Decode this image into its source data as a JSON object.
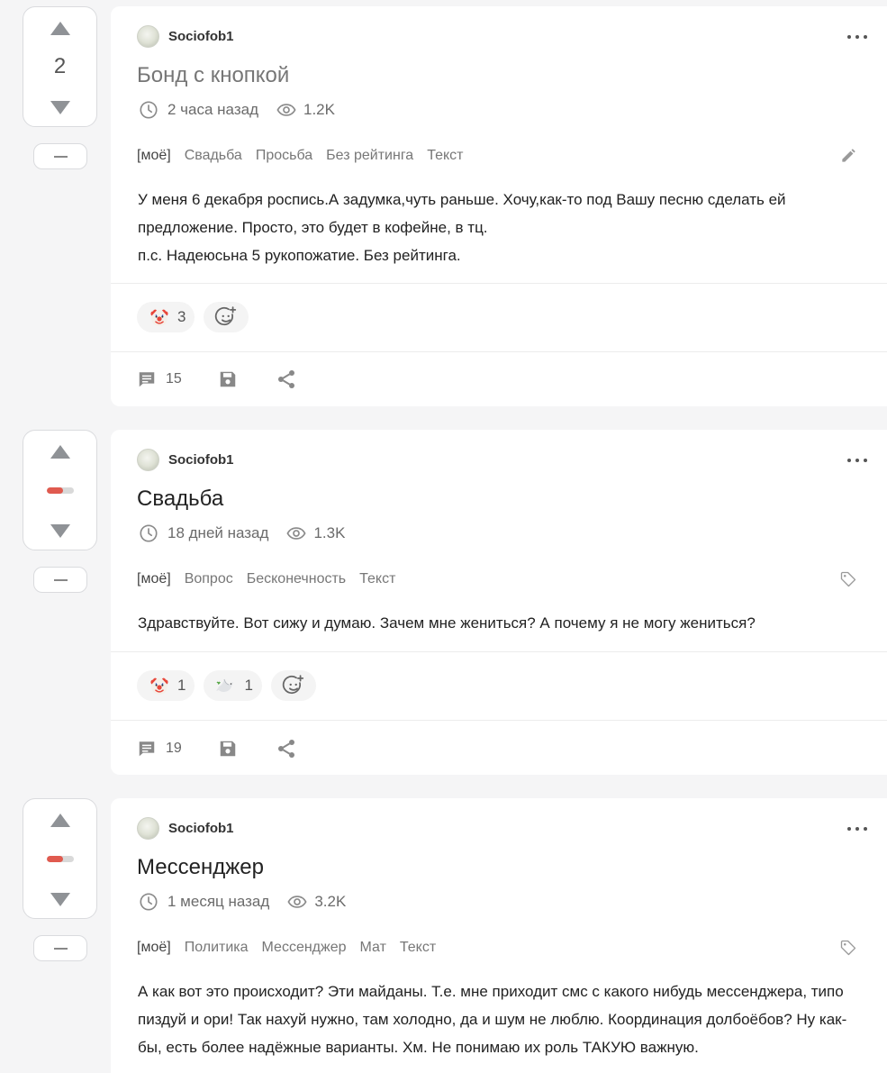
{
  "posts": [
    {
      "votes": "2",
      "rating_fraction": null,
      "author": "Sociofob1",
      "title": "Бонд с кнопкой",
      "time": "2 часа назад",
      "views": "1.2K",
      "tags": [
        "[моё]",
        "Свадьба",
        "Просьба",
        "Без рейтинга",
        "Текст"
      ],
      "tag_action_icon": "pencil-icon",
      "body": [
        "У меня 6 декабря роспись.А задумка,чуть раньше. Хочу,как-то под Вашу песню сделать ей предложение. Просто, это будет в кофейне, в тц.",
        "п.с. Надеюсьна 5 рукопожатие. Без рейтинга."
      ],
      "reactions": [
        {
          "icon": "clown-face-icon",
          "count": "3"
        }
      ],
      "comments": "15"
    },
    {
      "votes": null,
      "rating_fraction": 0.6,
      "author": "Sociofob1",
      "title": "Свадьба",
      "time": "18 дней назад",
      "views": "1.3K",
      "tags": [
        "[моё]",
        "Вопрос",
        "Бесконечность",
        "Текст"
      ],
      "tag_action_icon": "tag-icon",
      "body": [
        "Здравствуйте. Вот сижу и думаю. Зачем мне жениться? А почему я не могу жениться?"
      ],
      "reactions": [
        {
          "icon": "clown-face-icon",
          "count": "1"
        },
        {
          "icon": "dove-icon",
          "count": "1"
        }
      ],
      "comments": "19"
    },
    {
      "votes": null,
      "rating_fraction": 0.6,
      "author": "Sociofob1",
      "title": "Мессенджер",
      "time": "1 месяц назад",
      "views": "3.2K",
      "tags": [
        "[моё]",
        "Политика",
        "Мессенджер",
        "Мат",
        "Текст"
      ],
      "tag_action_icon": "tag-icon",
      "body": [
        "А как вот это происходит? Эти майданы. Т.е. мне приходит смс с какого нибудь мессенджера, типо пиздуй и ори! Так нахуй нужно, там холодно, да и шум не люблю. Координация долбоёбов? Ну как-бы, есть более надёжные варианты. Хм. Не понимаю их роль ТАКУЮ важную."
      ],
      "reactions": [],
      "comments": null
    }
  ],
  "colors": {
    "rating_negative": "#e05a4f",
    "background": "#f5f5f6",
    "card": "#ffffff"
  }
}
